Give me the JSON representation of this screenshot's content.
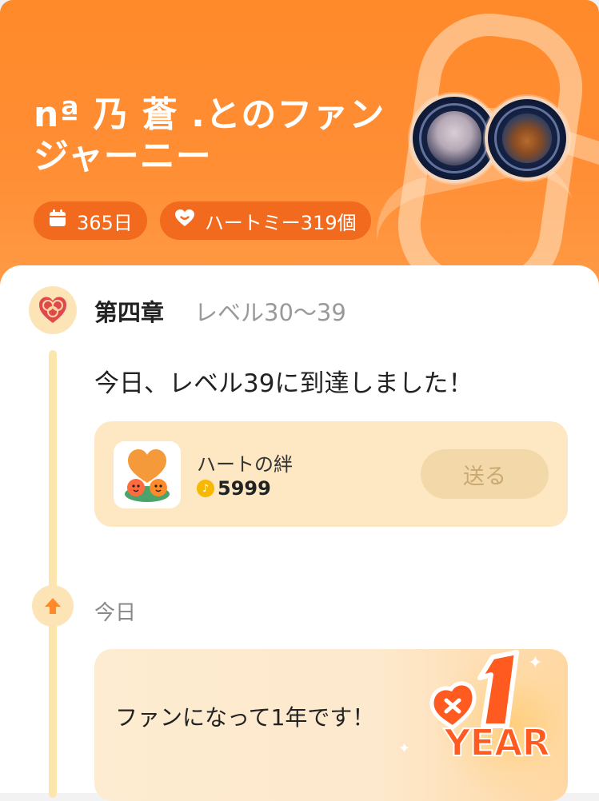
{
  "header": {
    "title": "nª 乃 蒼 .とのファンジャーニー",
    "days_chip": "365日",
    "heartme_chip": "ハートミー319個",
    "calendar_icon": "calendar-icon",
    "heart_icon": "heart-smile-icon"
  },
  "chapter": {
    "title": "第四章",
    "range": "レベル30〜39",
    "icon": "chapter-badge-icon"
  },
  "event1": {
    "message": "今日、レベル39に到達しました！",
    "gift": {
      "name": "ハートの絆",
      "price": "5999",
      "send_label": "送る"
    }
  },
  "event2": {
    "date": "今日",
    "message": "ファンになって1年です！",
    "badge_number": "1",
    "badge_word": "YEAR"
  },
  "colors": {
    "header_orange": "#ff8a2a",
    "chip": "#f26a1e",
    "timeline": "#fde6ad",
    "card_bg": "#fde8c3",
    "badge_orange": "#ff5a1f"
  }
}
